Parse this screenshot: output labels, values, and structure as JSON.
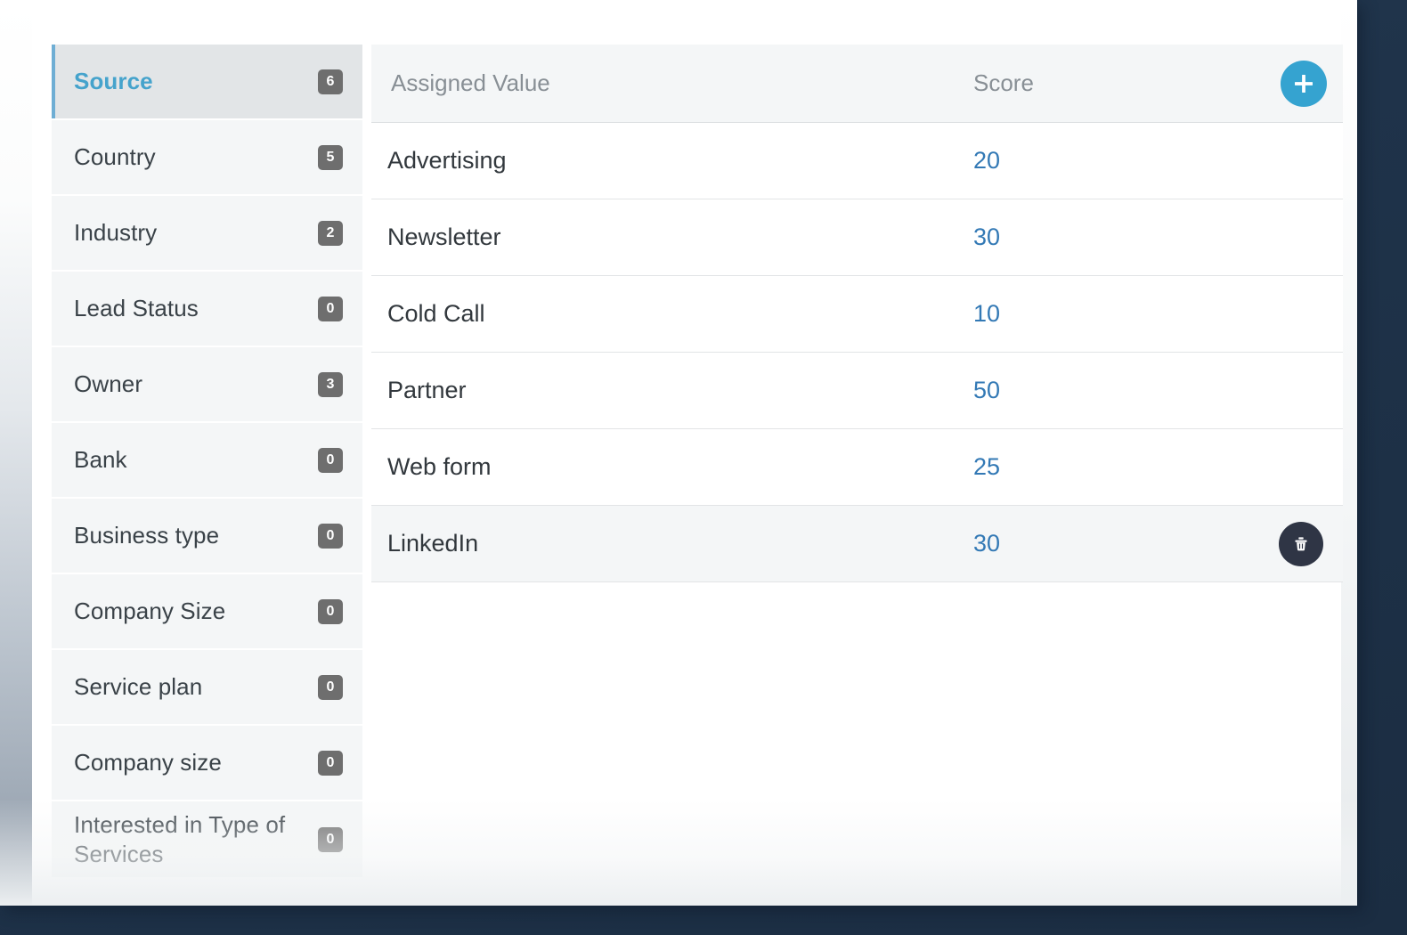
{
  "colors": {
    "accent_blue": "#35a3d0",
    "active_label_blue": "#45a3cc",
    "score_blue": "#3379b5",
    "badge_gray": "#6e6e6e",
    "delete_navy": "#2f3545",
    "backdrop_navy": "#22374f"
  },
  "sidebar": {
    "items": [
      {
        "label": "Source",
        "count": "6",
        "active": true
      },
      {
        "label": "Country",
        "count": "5",
        "active": false
      },
      {
        "label": "Industry",
        "count": "2",
        "active": false
      },
      {
        "label": "Lead Status",
        "count": "0",
        "active": false
      },
      {
        "label": "Owner",
        "count": "3",
        "active": false
      },
      {
        "label": "Bank",
        "count": "0",
        "active": false
      },
      {
        "label": "Business type",
        "count": "0",
        "active": false
      },
      {
        "label": "Company Size",
        "count": "0",
        "active": false
      },
      {
        "label": "Service plan",
        "count": "0",
        "active": false
      },
      {
        "label": "Company size",
        "count": "0",
        "active": false
      },
      {
        "label": "Interested in Type of Services",
        "count": "0",
        "active": false
      }
    ]
  },
  "table": {
    "columns": {
      "value": "Assigned Value",
      "score": "Score"
    },
    "add_button_icon": "plus-icon",
    "delete_button_icon": "trash-icon",
    "rows": [
      {
        "value": "Advertising",
        "score": "20",
        "highlight": false,
        "show_delete": false
      },
      {
        "value": "Newsletter",
        "score": "30",
        "highlight": false,
        "show_delete": false
      },
      {
        "value": "Cold Call",
        "score": "10",
        "highlight": false,
        "show_delete": false
      },
      {
        "value": "Partner",
        "score": "50",
        "highlight": false,
        "show_delete": false
      },
      {
        "value": "Web form",
        "score": "25",
        "highlight": false,
        "show_delete": false
      },
      {
        "value": "LinkedIn",
        "score": "30",
        "highlight": true,
        "show_delete": true
      }
    ]
  }
}
